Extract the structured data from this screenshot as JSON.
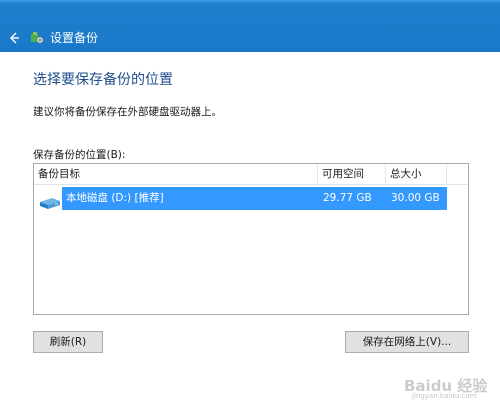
{
  "titlebar": {
    "back_icon": "arrow-left-icon",
    "app_icon": "backup-settings-icon",
    "title": "设置备份"
  },
  "main": {
    "heading": "选择要保存备份的位置",
    "description": "建议你将备份保存在外部硬盘驱动器上。",
    "location_label": "保存备份的位置(B):"
  },
  "listview": {
    "columns": [
      "备份目标",
      "可用空间",
      "总大小"
    ],
    "rows": [
      {
        "icon": "hard-drive-icon",
        "target": "本地磁盘 (D:) [推荐]",
        "free_space": "29.77 GB",
        "total_size": "30.00 GB",
        "selected": true
      }
    ]
  },
  "buttons": {
    "refresh": "刷新(R)",
    "save_network": "保存在网络上(V)..."
  },
  "watermark": {
    "text": "Baidu 经验",
    "sub": "jingyan.baidu.com"
  },
  "colors": {
    "titlebar": "#1a78c8",
    "heading": "#1f4e8c",
    "selection": "#3399ff",
    "button_bg": "#e1e1e1"
  }
}
